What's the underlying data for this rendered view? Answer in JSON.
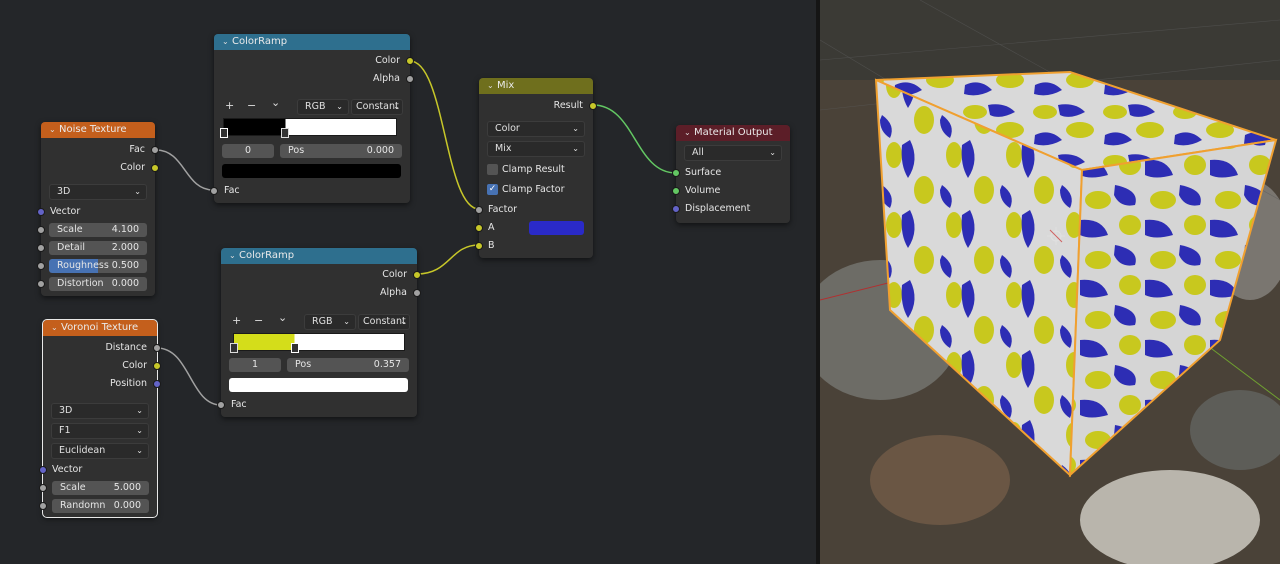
{
  "nodes": {
    "noise": {
      "title": "Noise Texture",
      "outputs": [
        "Fac",
        "Color"
      ],
      "dimensions": "3D",
      "vector_label": "Vector",
      "fields": [
        {
          "label": "Scale",
          "value": "4.100"
        },
        {
          "label": "Detail",
          "value": "2.000"
        },
        {
          "label": "Roughness",
          "value": "0.500"
        },
        {
          "label": "Distortion",
          "value": "0.000"
        }
      ]
    },
    "voronoi": {
      "title": "Voronoi Texture",
      "outputs": [
        "Distance",
        "Color",
        "Position"
      ],
      "dimensions": "3D",
      "feature": "F1",
      "metric": "Euclidean",
      "vector_label": "Vector",
      "fields": [
        {
          "label": "Scale",
          "value": "5.000"
        },
        {
          "label": "Randomn",
          "value": "0.000"
        }
      ]
    },
    "ramp1": {
      "title": "ColorRamp",
      "outputs": [
        "Color",
        "Alpha"
      ],
      "tools": [
        "+",
        "−",
        "⌄"
      ],
      "color_mode": "RGB",
      "interpolation": "Constant",
      "index": "0",
      "pos_label": "Pos",
      "pos_value": "0.000",
      "input": "Fac",
      "stop_position": 0.357,
      "colors": {
        "left": "#000000",
        "right": "#ffffff",
        "swatch": "#000000"
      }
    },
    "ramp2": {
      "title": "ColorRamp",
      "outputs": [
        "Color",
        "Alpha"
      ],
      "tools": [
        "+",
        "−",
        "⌄"
      ],
      "color_mode": "RGB",
      "interpolation": "Constant",
      "index": "1",
      "pos_label": "Pos",
      "pos_value": "0.357",
      "input": "Fac",
      "stop_position": 0.357,
      "colors": {
        "left": "#d4dd1a",
        "right": "#ffffff",
        "swatch": "#ffffff"
      }
    },
    "mix": {
      "title": "Mix",
      "output": "Result",
      "data_type": "Color",
      "blend_type": "Mix",
      "clamp_result": {
        "label": "Clamp Result",
        "checked": false
      },
      "clamp_factor": {
        "label": "Clamp Factor",
        "checked": true
      },
      "inputs": [
        "Factor",
        "A",
        "B"
      ],
      "a_color": "#2a2ac8"
    },
    "output": {
      "title": "Material Output",
      "target": "All",
      "inputs": [
        "Surface",
        "Volume",
        "Displacement"
      ]
    }
  },
  "colors": {
    "editor_bg": "#242629",
    "node_bg": "#303030",
    "texture_header": "#c45f1c",
    "converter_header": "#2e6f8e",
    "mix_header": "#6f6f1d",
    "output_header": "#5c1e28",
    "socket_yellow": "#c7c729",
    "socket_gray": "#a1a1a1",
    "socket_blue": "#6363c7",
    "socket_green": "#63c763",
    "cube_white": "#d9d9d9",
    "cube_blue": "#2d2db4",
    "cube_yellow": "#c8c81e"
  }
}
